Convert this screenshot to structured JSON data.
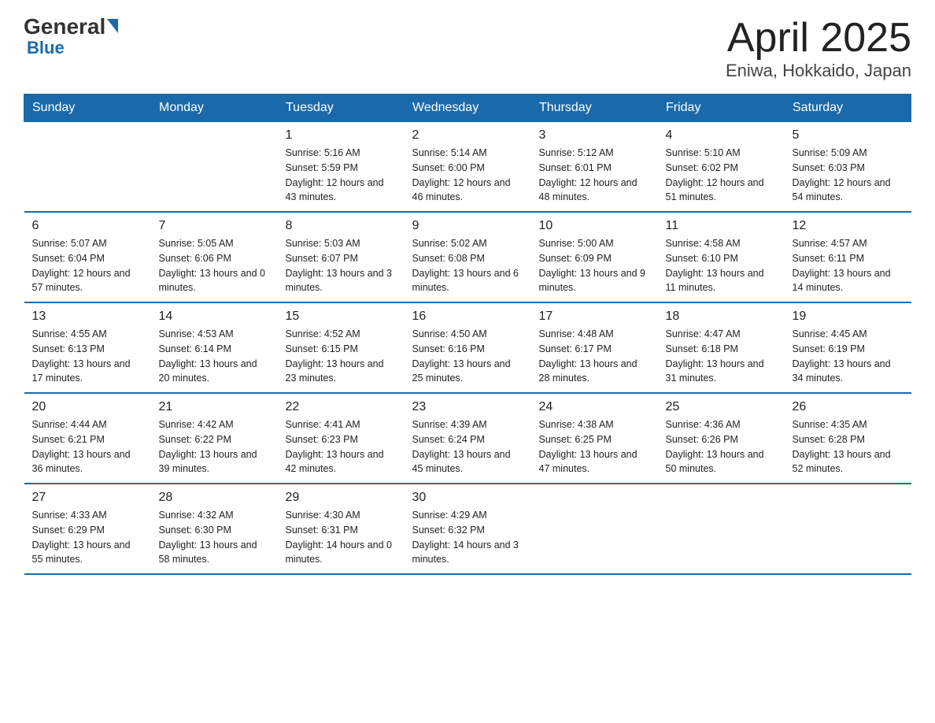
{
  "logo": {
    "general": "General",
    "blue": "Blue"
  },
  "title": "April 2025",
  "subtitle": "Eniwa, Hokkaido, Japan",
  "days_of_week": [
    "Sunday",
    "Monday",
    "Tuesday",
    "Wednesday",
    "Thursday",
    "Friday",
    "Saturday"
  ],
  "weeks": [
    [
      {
        "day": "",
        "info": ""
      },
      {
        "day": "",
        "info": ""
      },
      {
        "day": "1",
        "info": "Sunrise: 5:16 AM\nSunset: 5:59 PM\nDaylight: 12 hours\nand 43 minutes."
      },
      {
        "day": "2",
        "info": "Sunrise: 5:14 AM\nSunset: 6:00 PM\nDaylight: 12 hours\nand 46 minutes."
      },
      {
        "day": "3",
        "info": "Sunrise: 5:12 AM\nSunset: 6:01 PM\nDaylight: 12 hours\nand 48 minutes."
      },
      {
        "day": "4",
        "info": "Sunrise: 5:10 AM\nSunset: 6:02 PM\nDaylight: 12 hours\nand 51 minutes."
      },
      {
        "day": "5",
        "info": "Sunrise: 5:09 AM\nSunset: 6:03 PM\nDaylight: 12 hours\nand 54 minutes."
      }
    ],
    [
      {
        "day": "6",
        "info": "Sunrise: 5:07 AM\nSunset: 6:04 PM\nDaylight: 12 hours\nand 57 minutes."
      },
      {
        "day": "7",
        "info": "Sunrise: 5:05 AM\nSunset: 6:06 PM\nDaylight: 13 hours\nand 0 minutes."
      },
      {
        "day": "8",
        "info": "Sunrise: 5:03 AM\nSunset: 6:07 PM\nDaylight: 13 hours\nand 3 minutes."
      },
      {
        "day": "9",
        "info": "Sunrise: 5:02 AM\nSunset: 6:08 PM\nDaylight: 13 hours\nand 6 minutes."
      },
      {
        "day": "10",
        "info": "Sunrise: 5:00 AM\nSunset: 6:09 PM\nDaylight: 13 hours\nand 9 minutes."
      },
      {
        "day": "11",
        "info": "Sunrise: 4:58 AM\nSunset: 6:10 PM\nDaylight: 13 hours\nand 11 minutes."
      },
      {
        "day": "12",
        "info": "Sunrise: 4:57 AM\nSunset: 6:11 PM\nDaylight: 13 hours\nand 14 minutes."
      }
    ],
    [
      {
        "day": "13",
        "info": "Sunrise: 4:55 AM\nSunset: 6:13 PM\nDaylight: 13 hours\nand 17 minutes."
      },
      {
        "day": "14",
        "info": "Sunrise: 4:53 AM\nSunset: 6:14 PM\nDaylight: 13 hours\nand 20 minutes."
      },
      {
        "day": "15",
        "info": "Sunrise: 4:52 AM\nSunset: 6:15 PM\nDaylight: 13 hours\nand 23 minutes."
      },
      {
        "day": "16",
        "info": "Sunrise: 4:50 AM\nSunset: 6:16 PM\nDaylight: 13 hours\nand 25 minutes."
      },
      {
        "day": "17",
        "info": "Sunrise: 4:48 AM\nSunset: 6:17 PM\nDaylight: 13 hours\nand 28 minutes."
      },
      {
        "day": "18",
        "info": "Sunrise: 4:47 AM\nSunset: 6:18 PM\nDaylight: 13 hours\nand 31 minutes."
      },
      {
        "day": "19",
        "info": "Sunrise: 4:45 AM\nSunset: 6:19 PM\nDaylight: 13 hours\nand 34 minutes."
      }
    ],
    [
      {
        "day": "20",
        "info": "Sunrise: 4:44 AM\nSunset: 6:21 PM\nDaylight: 13 hours\nand 36 minutes."
      },
      {
        "day": "21",
        "info": "Sunrise: 4:42 AM\nSunset: 6:22 PM\nDaylight: 13 hours\nand 39 minutes."
      },
      {
        "day": "22",
        "info": "Sunrise: 4:41 AM\nSunset: 6:23 PM\nDaylight: 13 hours\nand 42 minutes."
      },
      {
        "day": "23",
        "info": "Sunrise: 4:39 AM\nSunset: 6:24 PM\nDaylight: 13 hours\nand 45 minutes."
      },
      {
        "day": "24",
        "info": "Sunrise: 4:38 AM\nSunset: 6:25 PM\nDaylight: 13 hours\nand 47 minutes."
      },
      {
        "day": "25",
        "info": "Sunrise: 4:36 AM\nSunset: 6:26 PM\nDaylight: 13 hours\nand 50 minutes."
      },
      {
        "day": "26",
        "info": "Sunrise: 4:35 AM\nSunset: 6:28 PM\nDaylight: 13 hours\nand 52 minutes."
      }
    ],
    [
      {
        "day": "27",
        "info": "Sunrise: 4:33 AM\nSunset: 6:29 PM\nDaylight: 13 hours\nand 55 minutes."
      },
      {
        "day": "28",
        "info": "Sunrise: 4:32 AM\nSunset: 6:30 PM\nDaylight: 13 hours\nand 58 minutes."
      },
      {
        "day": "29",
        "info": "Sunrise: 4:30 AM\nSunset: 6:31 PM\nDaylight: 14 hours\nand 0 minutes."
      },
      {
        "day": "30",
        "info": "Sunrise: 4:29 AM\nSunset: 6:32 PM\nDaylight: 14 hours\nand 3 minutes."
      },
      {
        "day": "",
        "info": ""
      },
      {
        "day": "",
        "info": ""
      },
      {
        "day": "",
        "info": ""
      }
    ]
  ]
}
